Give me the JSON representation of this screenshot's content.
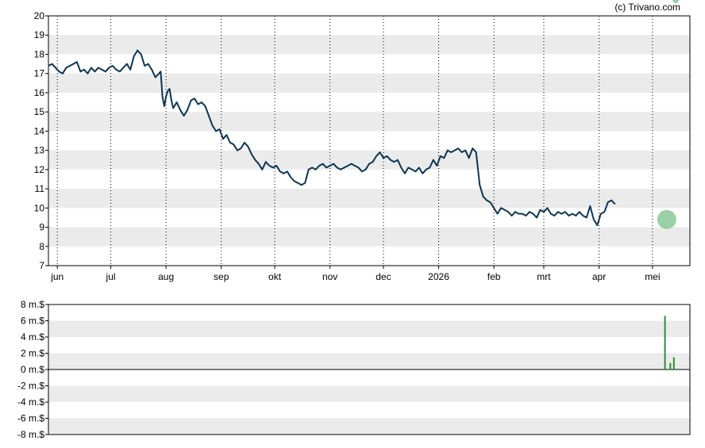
{
  "credit": "(c) Trivano.com",
  "colors": {
    "price_line": "#0d3552",
    "band": "#ebebeb",
    "volume": "#2e8b3a",
    "highlight": "#7fc48f",
    "axis": "#000000"
  },
  "chart_data": [
    {
      "type": "line",
      "grid": true,
      "ylim": [
        7,
        20
      ],
      "y_ticks": [
        "7",
        "8",
        "9",
        "10",
        "11",
        "12",
        "13",
        "14",
        "15",
        "16",
        "17",
        "18",
        "19",
        "20"
      ],
      "x_ticks": [
        "jun",
        "jul",
        "aug",
        "sep",
        "okt",
        "nov",
        "dec",
        "2026",
        "feb",
        "mrt",
        "apr",
        "mei"
      ],
      "x_tick_days": [
        0,
        30,
        61,
        92,
        122,
        153,
        183,
        214,
        245,
        273,
        304,
        334
      ],
      "xlim_days": [
        -5,
        355
      ],
      "series": [
        {
          "days": [
            -5,
            -3,
            -1,
            1,
            3,
            5,
            7,
            9,
            11,
            13,
            15,
            17,
            19,
            21,
            23,
            25,
            27,
            29,
            31,
            33,
            35,
            37,
            39,
            41,
            43,
            45,
            47,
            49,
            51,
            53,
            55,
            57,
            58,
            59,
            60,
            61,
            62,
            63,
            64,
            65,
            67,
            69,
            71,
            73,
            75,
            77,
            79,
            81,
            83,
            85,
            87,
            89,
            91,
            93,
            95,
            97,
            99,
            101,
            103,
            105,
            107,
            109,
            111,
            113,
            115,
            117,
            119,
            121,
            123,
            125,
            127,
            129,
            131,
            133,
            135,
            137,
            139,
            141,
            143,
            145,
            147,
            149,
            151,
            153,
            155,
            157,
            159,
            161,
            163,
            165,
            167,
            169,
            171,
            173,
            175,
            177,
            179,
            181,
            183,
            185,
            187,
            189,
            191,
            193,
            195,
            197,
            199,
            201,
            203,
            205,
            207,
            209,
            211,
            213,
            215,
            217,
            219,
            221,
            223,
            225,
            227,
            229,
            231,
            233,
            235,
            237,
            239,
            241,
            243,
            245,
            247,
            249,
            251,
            253,
            255,
            257,
            259,
            261,
            263,
            265,
            267,
            269,
            271,
            273,
            275,
            277,
            279,
            281,
            283,
            285,
            287,
            289,
            291,
            293,
            295,
            297,
            299,
            301,
            303,
            305,
            307,
            309,
            311,
            313,
            315,
            317,
            319,
            321,
            323,
            325,
            327,
            329,
            331,
            333,
            335,
            337,
            339,
            341,
            343,
            345,
            347,
            349,
            351,
            353,
            355
          ],
          "values": [
            17.4,
            17.5,
            17.3,
            17.1,
            17.0,
            17.3,
            17.4,
            17.5,
            17.6,
            17.1,
            17.2,
            17.0,
            17.3,
            17.1,
            17.3,
            17.2,
            17.1,
            17.3,
            17.4,
            17.2,
            17.1,
            17.3,
            17.5,
            17.2,
            17.9,
            18.2,
            18.0,
            17.4,
            17.5,
            17.2,
            16.8,
            17.0,
            17.1,
            15.8,
            15.3,
            15.8,
            16.1,
            16.2,
            15.6,
            15.2,
            15.5,
            15.1,
            14.8,
            15.1,
            15.6,
            15.7,
            15.4,
            15.5,
            15.3,
            14.8,
            14.3,
            14.0,
            14.1,
            13.6,
            13.8,
            13.4,
            13.3,
            13.0,
            13.1,
            13.4,
            13.2,
            12.8,
            12.5,
            12.3,
            12.0,
            12.4,
            12.2,
            12.1,
            12.2,
            11.9,
            11.8,
            11.9,
            11.6,
            11.4,
            11.3,
            11.2,
            11.3,
            12.0,
            12.1,
            12.0,
            12.2,
            12.3,
            12.1,
            12.2,
            12.3,
            12.1,
            12.0,
            12.1,
            12.2,
            12.3,
            12.2,
            12.1,
            11.9,
            12.0,
            12.3,
            12.4,
            12.7,
            12.9,
            12.6,
            12.7,
            12.5,
            12.4,
            12.5,
            12.1,
            11.8,
            12.1,
            12.0,
            11.9,
            12.1,
            11.8,
            12.0,
            12.1,
            12.5,
            12.2,
            12.7,
            12.6,
            13.0,
            12.9,
            13.0,
            13.1,
            12.9,
            13.0,
            12.6,
            13.1,
            12.9,
            11.2,
            10.6,
            10.4,
            10.3,
            10.0,
            9.7,
            10.0,
            9.9,
            9.8,
            9.6,
            9.8,
            9.7,
            9.7,
            9.6,
            9.8,
            9.7,
            9.5,
            9.9,
            9.8,
            10.0,
            9.7,
            9.6,
            9.8,
            9.7,
            9.8,
            9.6,
            9.7,
            9.6,
            9.8,
            9.6,
            9.5,
            10.1,
            9.4,
            9.1,
            9.7,
            9.8,
            10.3,
            10.4,
            10.2
          ],
          "highlight": {
            "day": 342,
            "value": 9.4
          }
        }
      ]
    },
    {
      "type": "bar",
      "grid": true,
      "ylim": [
        -8,
        8
      ],
      "y_ticks": [
        "-8 m.$",
        "-6 m.$",
        "-4 m.$",
        "-2 m.$",
        "0 m.$",
        "2 m.$",
        "4 m.$",
        "6 m.$",
        "8 m.$"
      ],
      "bars": [
        {
          "day": 341,
          "value": 6.6
        },
        {
          "day": 344,
          "value": 0.8
        },
        {
          "day": 346,
          "value": 1.5
        }
      ]
    }
  ]
}
